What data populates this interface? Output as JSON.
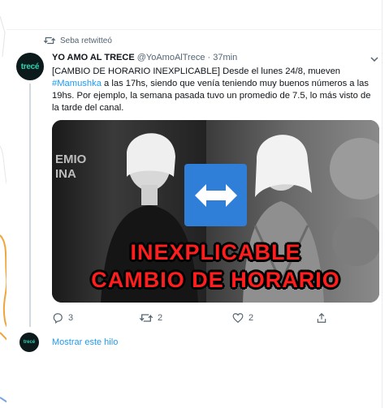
{
  "retweet": {
    "label": "Seba retwitteó"
  },
  "tweet": {
    "avatar_text": "trecé",
    "name": "YO AMO AL TRECE",
    "handle": "@YoAmoAlTrece",
    "time": "· 37min",
    "text_before": "[CAMBIO DE HORARIO INEXPLICABLE] Desde el lunes 24/8, mueven ",
    "hashtag": "#Mamushka",
    "text_after": " a las 17hs, siendo que venía teniendo muy buenos números a las 19hs. Por ejemplo, la semana pasada tuvo un promedio de 7.5, lo más visto de la tarde del canal.",
    "image": {
      "bg_text": "EMIO\nINA",
      "line1": "INEXPLICABLE",
      "line2": "CAMBIO DE HORARIO"
    },
    "actions": {
      "replies": "3",
      "retweets": "2",
      "likes": "2"
    }
  },
  "show_thread": {
    "avatar_text": "trecé",
    "label": "Mostrar este hilo"
  },
  "colors": {
    "accent": "#1d9bf0",
    "secondary": "#536471",
    "image_text": "#ff1e1e",
    "arrow_box": "#2f7ed8"
  }
}
